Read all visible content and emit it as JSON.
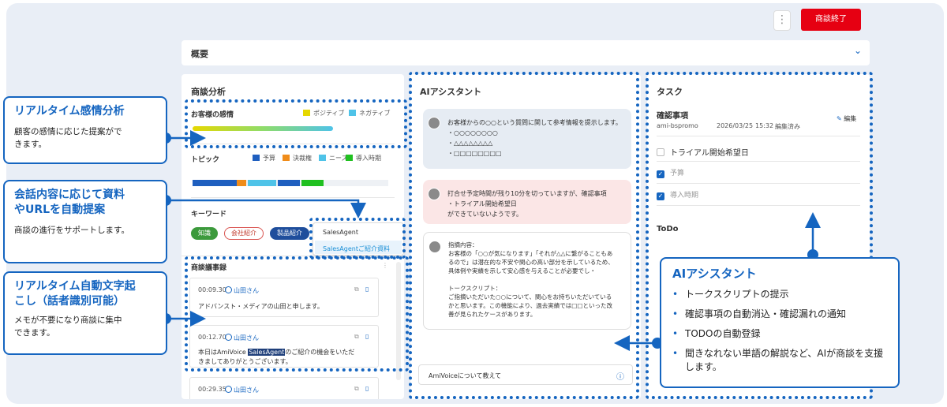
{
  "header": {
    "more_icon": "⋮",
    "end_button": "商談終了",
    "end_color": "#e60012"
  },
  "overview": {
    "title": "概要"
  },
  "analysis": {
    "title": "商談分析",
    "emotion": {
      "title": "お客様の感情",
      "positive": "ポジティブ",
      "negative": "ネガティブ",
      "positive_color": "#e6d800",
      "negative_color": "#4fc3e8"
    },
    "topic": {
      "title": "トピック",
      "legend": [
        {
          "label": "予算",
          "color": "#1f5fbf"
        },
        {
          "label": "決裁権",
          "color": "#f08c1a"
        },
        {
          "label": "ニーズ",
          "color": "#4fc3e8"
        },
        {
          "label": "導入時期",
          "color": "#20c020"
        }
      ]
    },
    "keyword": {
      "title": "キーワード",
      "tags": [
        "知識",
        "会社紹介",
        "製品紹介"
      ],
      "dropdown": [
        "SalesAgent",
        "SalesAgentご紹介資料"
      ]
    },
    "transcript": {
      "title": "商談議事録",
      "entries": [
        {
          "time": "00:09.30",
          "speaker": "山田さん",
          "text": "アドバンスト・メディアの山田と申します。"
        },
        {
          "time": "00:12.70",
          "speaker": "山田さん",
          "text_before": "本日はAmiVoice ",
          "highlight": "SalesAgent",
          "text_after": "のご紹介の機会をいただ",
          "text2": "きましてありがとうございます。"
        },
        {
          "time": "00:29.35",
          "speaker": "山田さん"
        }
      ]
    }
  },
  "assistant": {
    "title": "AIアシスタント",
    "messages": [
      "お客様からの○○という質問に関して参考情報を提示します。\n・○○○○○○○○\n・△△△△△△△△\n・□□□□□□□□",
      "打合せ予定時間が残り10分を切っていますが、確認事項\n・トライアル開始希望日\nができていないようです。",
      "指摘内容：\nお客様の「○○が気になります」「それが△△に繋がることもあ\nるので」は潜在的な不安や関心の高い部分を示しているため、\n具体例や実績を示して安心感を与えることが必要でし・\n\nトークスクリプト：\nご指摘いただいた○○について、関心をお持ちいただいている\nかと思います。この機能により、過去実績では□□といった改\n善が見られたケースがあります。"
    ],
    "input": "AmiVoiceについて教えて"
  },
  "task": {
    "title": "タスク",
    "confirm": {
      "title": "確認事項",
      "edit": "編集",
      "user": "ami-bspromo",
      "date": "2026/03/25",
      "time": "15:32",
      "status": "編集済み",
      "items": [
        {
          "label": "トライアル開始希望日",
          "checked": false
        },
        {
          "label": "予算",
          "checked": true
        },
        {
          "label": "導入時期",
          "checked": true
        }
      ]
    },
    "todo": {
      "title": "ToDo"
    }
  },
  "callouts": {
    "emotion": {
      "title": "リアルタイム感情分析",
      "body1": "顧客の感情に応じた提案がで",
      "body2": "きます。"
    },
    "material": {
      "title1": "会話内容に応じて資料",
      "title2": "やURLを自動提案",
      "body": "商談の進行をサポートします。"
    },
    "transcribe": {
      "title1": "リアルタイム自動文字起",
      "title2": "こし（話者識別可能）",
      "body1": "メモが不要になり商談に集中",
      "body2": "できます。"
    },
    "ai": {
      "title": "AIアシスタント",
      "items": [
        "トークスクリプトの提示",
        "確認事項の自動消込・確認漏れの通知",
        "TODOの自動登録",
        "聞きなれない単語の解説など、AIが商談を支援します。"
      ]
    }
  }
}
